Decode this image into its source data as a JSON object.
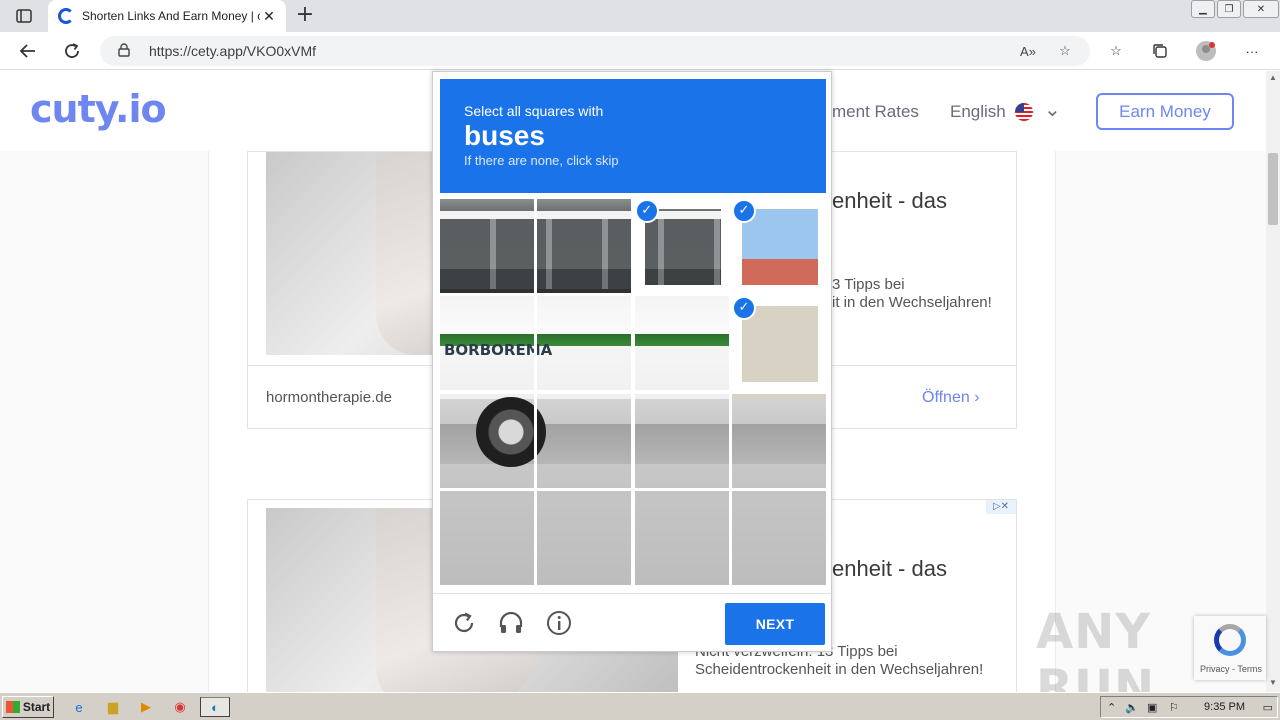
{
  "browser": {
    "tab_title": "Shorten Links And Earn Money | c",
    "url": "https://cety.app/VKO0xVMf"
  },
  "site": {
    "logo": "cuty.io",
    "nav_partial": "ment Rates",
    "language": "English",
    "earn_button": "Earn Money"
  },
  "ads": [
    {
      "headline": "enheit - das",
      "text_line1": "3 Tipps bei",
      "text_line2": "it in den Wechseljahren!",
      "domain": "hormontherapie.de",
      "open_label": "Öffnen"
    },
    {
      "headline": "enheit - das",
      "text_line1": "Nicht verzweifeln: 13 Tipps bei",
      "text_line2": "Scheidentrockenheit in den Wechseljahren!"
    }
  ],
  "captcha": {
    "instruction": "Select all squares with",
    "target": "buses",
    "subtext": "If there are none, click skip",
    "next_label": "NEXT",
    "bus_text": "BORBOREMA",
    "selected_tiles": [
      2,
      3,
      7
    ],
    "check_mark": "✓"
  },
  "watermark": "ANY RUN",
  "recaptcha_badge": {
    "links": "Privacy - Terms"
  },
  "taskbar": {
    "start_label": "Start",
    "clock": "9:35 PM"
  },
  "colors": {
    "captcha_blue": "#1a73e8",
    "brand": "#6d86f0"
  }
}
